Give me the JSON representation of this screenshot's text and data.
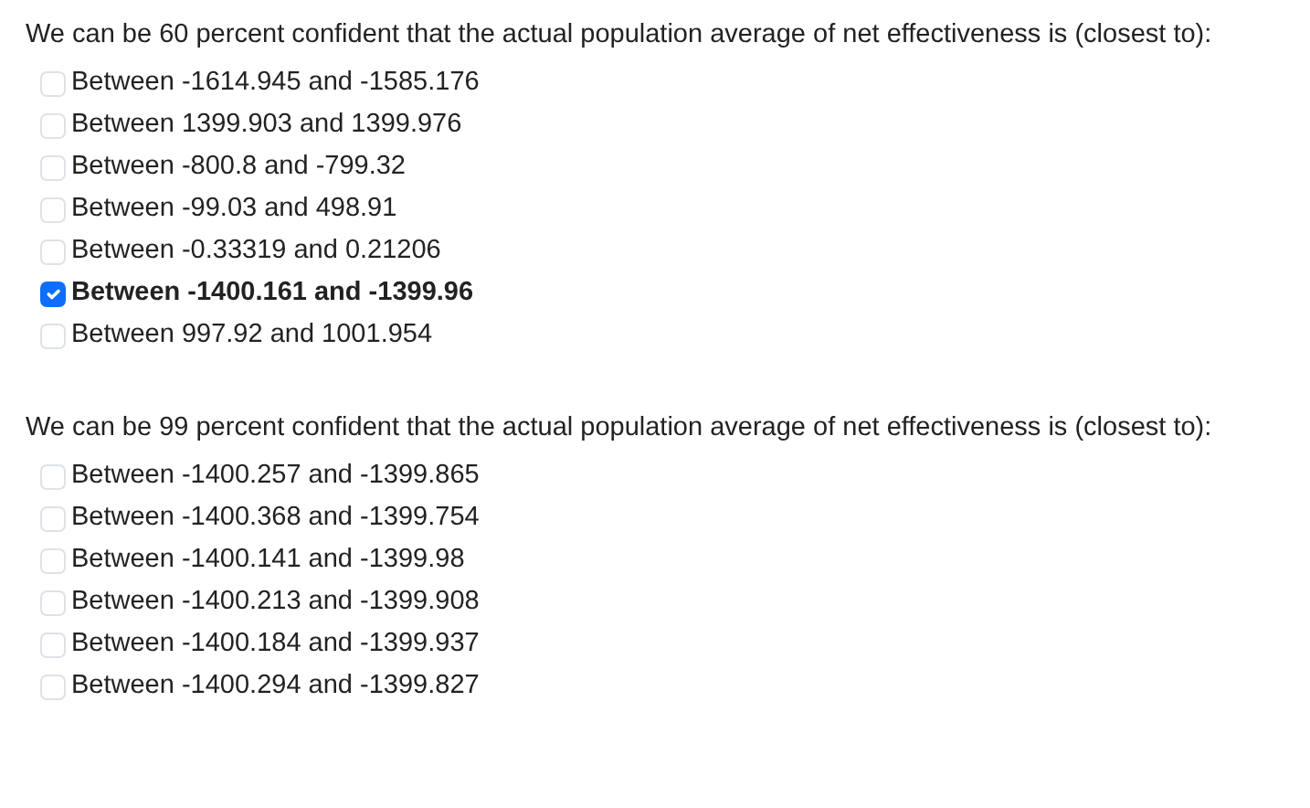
{
  "questions": [
    {
      "prompt": "We can be 60 percent confident that the actual population average of net effectiveness is (closest to):",
      "options": [
        {
          "label": "Between -1614.945 and -1585.176",
          "checked": false
        },
        {
          "label": "Between 1399.903 and 1399.976",
          "checked": false
        },
        {
          "label": "Between -800.8 and -799.32",
          "checked": false
        },
        {
          "label": "Between -99.03 and 498.91",
          "checked": false
        },
        {
          "label": "Between -0.33319 and 0.21206",
          "checked": false
        },
        {
          "label": "Between -1400.161 and -1399.96",
          "checked": true
        },
        {
          "label": "Between 997.92 and 1001.954",
          "checked": false
        }
      ]
    },
    {
      "prompt": "We can be 99 percent confident that the actual population average of net effectiveness is (closest to):",
      "options": [
        {
          "label": "Between -1400.257 and -1399.865",
          "checked": false
        },
        {
          "label": "Between -1400.368 and -1399.754",
          "checked": false
        },
        {
          "label": "Between -1400.141 and -1399.98",
          "checked": false
        },
        {
          "label": "Between -1400.213 and -1399.908",
          "checked": false
        },
        {
          "label": "Between -1400.184 and -1399.937",
          "checked": false
        },
        {
          "label": "Between -1400.294 and -1399.827",
          "checked": false
        }
      ]
    }
  ]
}
